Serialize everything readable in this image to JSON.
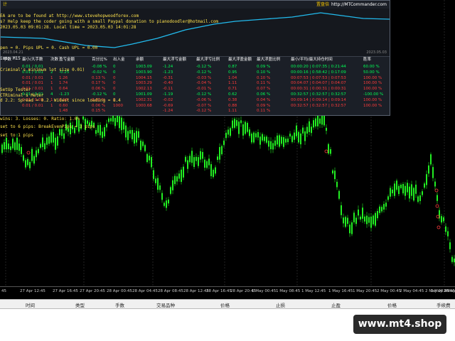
{
  "panel": {
    "title": "计",
    "brand_cn": "置盘倍",
    "brand_url": "http://MTCommander.com",
    "date_left": "2023.04.21",
    "date_right": "2023.05.03"
  },
  "overlay_lines": [
    {
      "text": "EA are to be found at http://www.stevehopwoodforex.com",
      "color": "#ffe34d"
    },
    {
      "text": "s? Help keep the coder going with a small Paypal donation to pianodoodler@hotmail.com",
      "color": "#ffe34d"
    },
    {
      "text": "2023.05.03 09:01:28. Local time = 2023.05.03 14:01:28",
      "color": "#ffe34d"
    },
    {
      "text": "pen = 0. Pips UPL = 0. Cash UPL = 0.00",
      "color": "#ffe34d"
    },
    {
      "text": "ime: M15",
      "color": "#ffffff"
    },
    {
      "text": "Criminal's minimum lot size 0.01)",
      "color": "#ffe34d"
    },
    {
      "text": "SetUp Tester",
      "color": "#ffe34d"
    },
    {
      "text": "CTRiminal's Meter",
      "color": "#ffe34d"
    },
    {
      "text": "d 2.2: Spread = 0.2. Widest since loading = 8.4",
      "color": "#ffe34d"
    },
    {
      "text": "wins: 3. Losses: 0. Ratio: 1.0%",
      "color": "#ffe34d"
    },
    {
      "text": "set to 6 pips: BreakEvenPips = 3 pips",
      "color": "#ffe34d"
    },
    {
      "text": "set to 1 pips",
      "color": "#ffe34d"
    }
  ],
  "stats": {
    "headers": [
      "手数",
      "最小/大手数",
      "次数",
      "盈亏金额",
      "百分比%",
      "出入金",
      "余额",
      "最大浮亏金额",
      "最大浮亏比例",
      "最大浮盈金额",
      "最大浮盈比例",
      "最小/平均/最大持仓时间",
      "胜率"
    ],
    "rows": [
      {
        "color": "#00ff55",
        "cells": [
          "",
          "0.01 / 0.01",
          "",
          "",
          "-0.08 %",
          "0",
          "1003.09",
          "-1.24",
          "-0.12 %",
          "0.87",
          "0.09 %",
          "00:00:20 | 0:07:35 | 0:21:44",
          "60.00 %"
        ]
      },
      {
        "color": "#00ff55",
        "cells": [
          "",
          "0.01 / 0.01",
          "2",
          "-0.25",
          "-0.02 %",
          "0",
          "1003.90",
          "-1.23",
          "-0.12 %",
          "0.95",
          "0.10 %",
          "00:00:16 | 0:58:42 | 0:17:09",
          "50.00 %"
        ]
      },
      {
        "color": "#ff3b3b",
        "cells": [
          "",
          "0.01 / 0.01",
          "1",
          "1.26",
          "0.13 %",
          "0",
          "1004.15",
          "-0.31",
          "-0.03 %",
          "1.04",
          "0.10 %",
          "00:07:53 | 0:07:53 | 0:07:53",
          "100.00 %"
        ]
      },
      {
        "color": "#ff3b3b",
        "cells": [
          "",
          "0.01 / 0.01",
          "1",
          "1.74",
          "0.17 %",
          "0",
          "1003.29",
          "-0.40",
          "-0.04 %",
          "1.11",
          "0.11 %",
          "00:04:07 | 0:04:07 | 0:04:07",
          "100.00 %"
        ]
      },
      {
        "color": "#ff3b3b",
        "cells": [
          "",
          "0.01 / 0.01",
          "1",
          "0.64",
          "0.06 %",
          "0",
          "1002.13",
          "-0.11",
          "-0.01 %",
          "0.71",
          "0.07 %",
          "00:00:31 | 0:00:31 | 0:00:31",
          "100.00 %"
        ]
      },
      {
        "color": "#00ff55",
        "cells": [
          "",
          "0.01 / 0.01",
          "4",
          "-1.23",
          "-0.12 %",
          "0",
          "1001.09",
          "-1.19",
          "-0.12 %",
          "0.62",
          "0.06 %",
          "00:32:57 | 0:32:57 | 0:32:57",
          "-100.00 %"
        ]
      },
      {
        "color": "#ff3b3b",
        "cells": [
          "",
          "0.01 / 0.01",
          "1",
          "0.16",
          "0.02 %",
          "0",
          "1002.31",
          "-0.02",
          "-0.06 %",
          "0.38",
          "0.04 %",
          "00:09:14 | 0:09:14 | 0:09:14",
          "100.00 %"
        ]
      },
      {
        "color": "#ff3b3b",
        "cells": [
          "",
          "0.01 / 0.01",
          "1",
          "0.60",
          "0.06 %",
          "1000",
          "1000.68",
          "-0.69",
          "-0.07 %",
          "0.88",
          "0.09 %",
          "00:32:57 | 0:32:57 | 0:32:57",
          "100.00 %"
        ]
      },
      {
        "color": "#ff3b3b",
        "cells": [
          "",
          "",
          "",
          "1.48",
          "0.15 %",
          "",
          "",
          "-1.24",
          "-0.12 %",
          "1.11",
          "0.11 %",
          "",
          ""
        ]
      }
    ]
  },
  "axis": {
    "labels": [
      "45",
      "27 Apr 12:45",
      "27 Apr 16:45",
      "27 Apr 20:45",
      "28 Apr 00:45",
      "28 Apr 04:45",
      "28 Apr 08:45",
      "28 Apr 12:45",
      "28 Apr 16:45",
      "28 Apr 20:45",
      "1 May 00:45",
      "1 May 08:45",
      "1 May 12:45",
      "1 May 16:45",
      "1 May 20:45",
      "2 May 00:45",
      "2 May 04:45",
      "2 May 08:45",
      "2 May 12:45",
      "2 May 16:45"
    ]
  },
  "terminal": {
    "columns": [
      "时间",
      "类型",
      "手数",
      "交易品种",
      "价格",
      "止损",
      "止盈",
      "价格",
      "手续费"
    ]
  },
  "watermark": "www.mt4.shop",
  "colors": {
    "candle": "#22ee22",
    "equity_line": "#22bbee",
    "marker": "#ff4040"
  }
}
